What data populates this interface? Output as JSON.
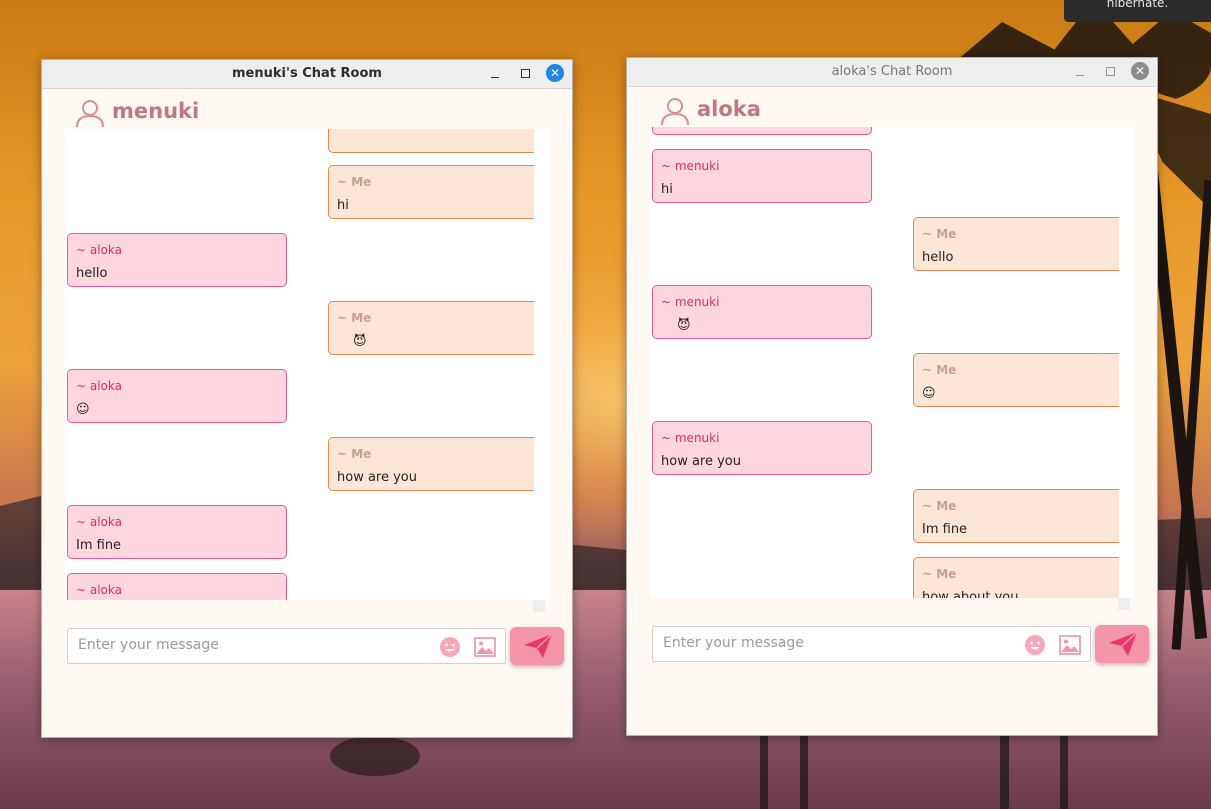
{
  "system": {
    "notification_text": "hibernate."
  },
  "colors": {
    "accent_pink": "#f595aa",
    "other_bubble": "#ffd6e0",
    "me_bubble": "#fde6d6",
    "username": "#c0787c",
    "close_active": "#1e88e5"
  },
  "windows": [
    {
      "title": "menuki's Chat Room",
      "active": true,
      "user": "menuki",
      "messages": [
        {
          "side": "me",
          "sender": "",
          "text": ""
        },
        {
          "side": "me",
          "sender": "~ Me",
          "text": "hi"
        },
        {
          "side": "other",
          "sender": "~ aloka",
          "text": "hello"
        },
        {
          "side": "me",
          "sender": "~ Me",
          "text": "😈"
        },
        {
          "side": "other",
          "sender": "~ aloka",
          "text": "☺"
        },
        {
          "side": "me",
          "sender": "~ Me",
          "text": "how are you"
        },
        {
          "side": "other",
          "sender": "~ aloka",
          "text": "Im fine"
        },
        {
          "side": "other",
          "sender": "~ aloka",
          "text": ""
        }
      ],
      "input_placeholder": "Enter your message"
    },
    {
      "title": "aloka's Chat Room",
      "active": false,
      "user": "aloka",
      "messages": [
        {
          "side": "other",
          "sender": "",
          "text": ""
        },
        {
          "side": "other",
          "sender": "~ menuki",
          "text": "hi"
        },
        {
          "side": "me",
          "sender": "~ Me",
          "text": "hello"
        },
        {
          "side": "other",
          "sender": "~ menuki",
          "text": "😈"
        },
        {
          "side": "me",
          "sender": "~ Me",
          "text": "☺"
        },
        {
          "side": "other",
          "sender": "~ menuki",
          "text": "how are you"
        },
        {
          "side": "me",
          "sender": "~ Me",
          "text": "Im fine"
        },
        {
          "side": "me",
          "sender": "~ Me",
          "text": "how about you"
        }
      ],
      "input_placeholder": "Enter your message"
    }
  ],
  "icons": {
    "minimize": "minimize-icon",
    "maximize": "maximize-icon",
    "close": "close-icon",
    "user": "user-icon",
    "emoji": "emoji-icon",
    "image": "image-icon",
    "send": "paper-plane-icon"
  }
}
